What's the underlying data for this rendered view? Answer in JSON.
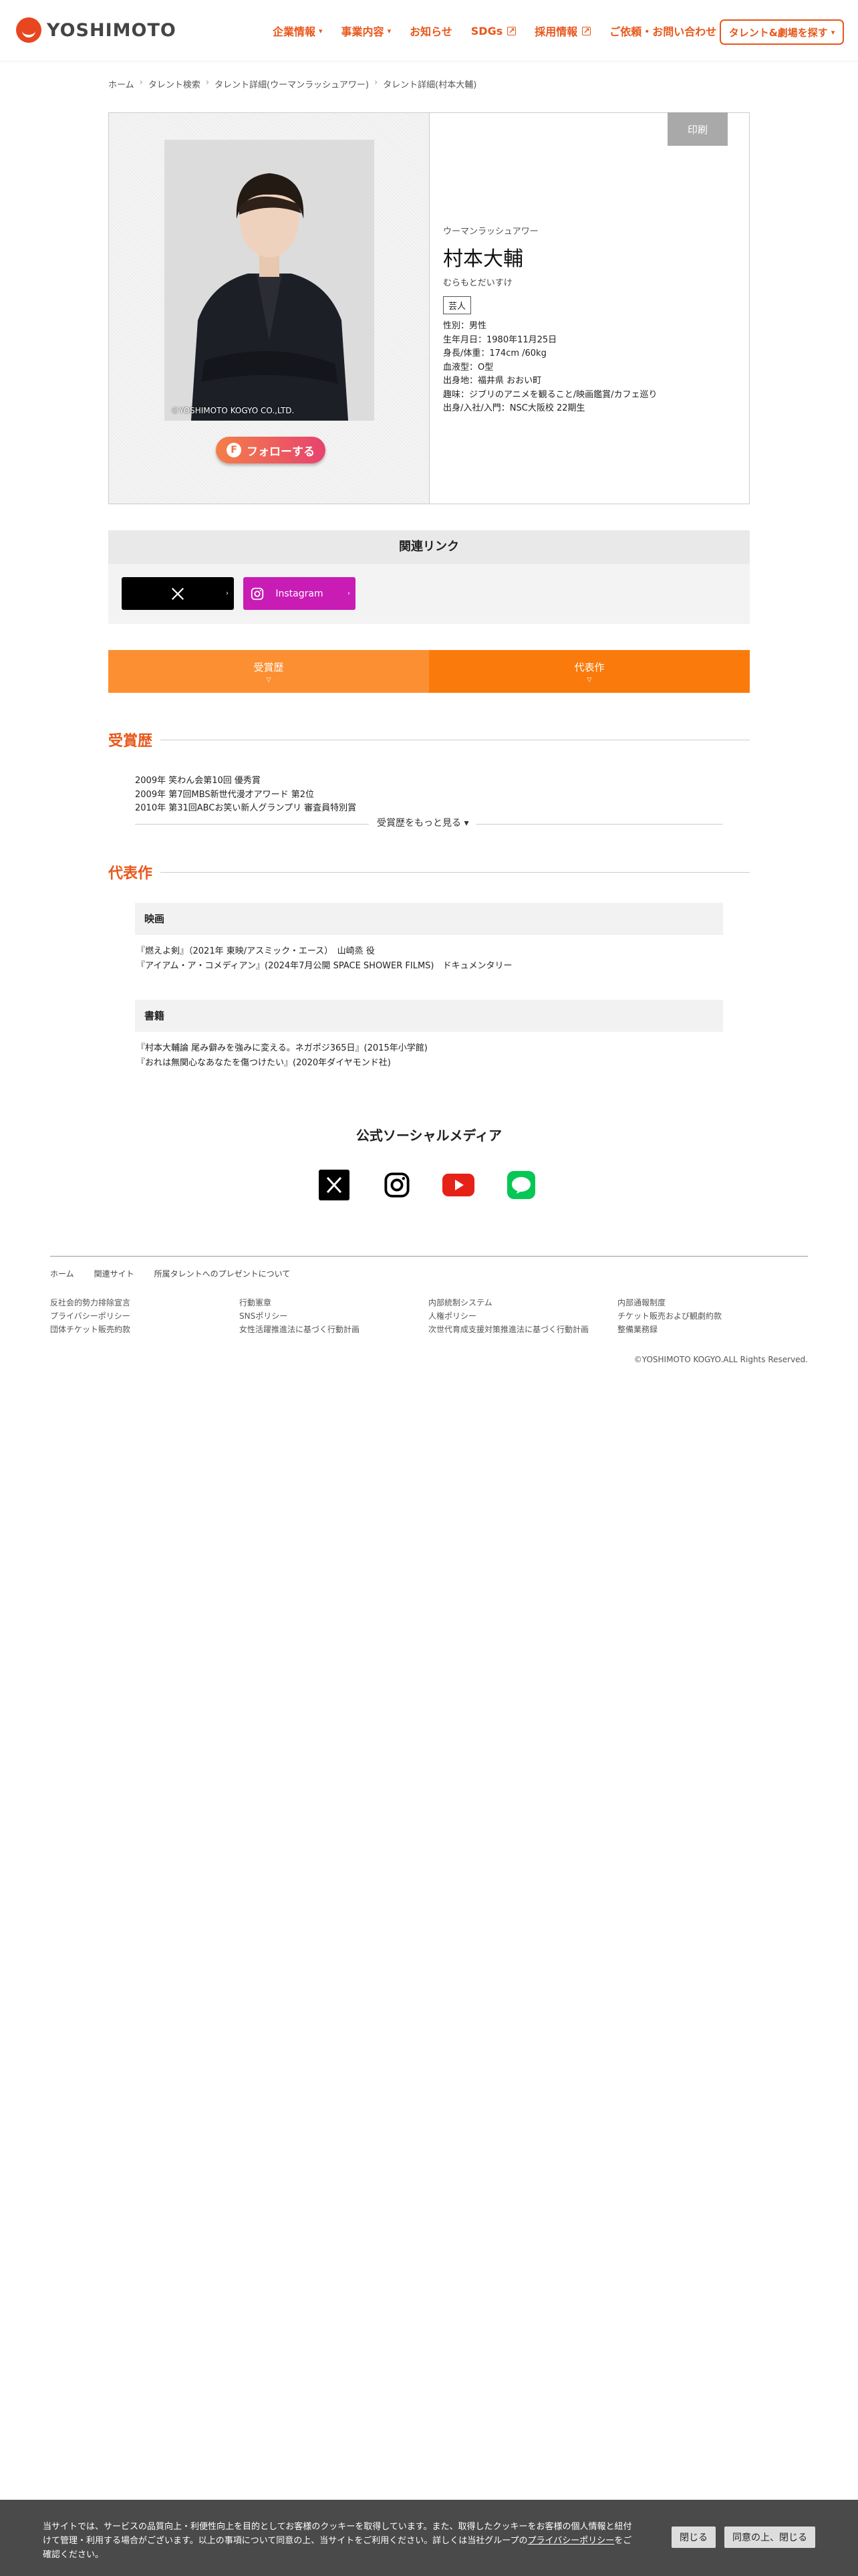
{
  "header": {
    "logo_text": "YOSHIMOTO",
    "nav": [
      {
        "label": "企業情報",
        "icon": "chevron-down-icon"
      },
      {
        "label": "事業内容",
        "icon": "chevron-down-icon"
      },
      {
        "label": "お知らせ",
        "icon": ""
      },
      {
        "label": "SDGs",
        "icon": "external-link-icon"
      },
      {
        "label": "採用情報",
        "icon": "external-link-icon"
      },
      {
        "label": "ご依頼・お問い合わせ",
        "icon": ""
      }
    ],
    "talent_button": "タレント&劇場を探す"
  },
  "breadcrumb": [
    "ホーム",
    "タレント検索",
    "タレント詳細(ウーマンラッシュアワー)",
    "タレント詳細(村本大輔)"
  ],
  "profile": {
    "print_label": "印刷",
    "copyright": "©YOSHIMOTO KOGYO CO.,LTD.",
    "follow_label": "フォローする",
    "unit": "ウーマンラッシュアワー",
    "name": "村本大輔",
    "kana": "むらもとだいすけ",
    "tag": "芸人",
    "details": [
      "性別：男性",
      "生年月日：1980年11月25日",
      "身長/体重：174cm /60kg",
      "血液型：O型",
      "出身地：福井県 おおい町",
      "趣味：ジブリのアニメを観ること/映画鑑賞/カフェ巡り",
      "出身/入社/入門：NSC大阪校 22期生"
    ]
  },
  "links": {
    "title": "関連リンク",
    "items": [
      {
        "label": "X",
        "color": "#000000"
      },
      {
        "label": "Instagram",
        "color": "#c91cb5"
      }
    ]
  },
  "tabs": [
    {
      "label": "受賞歴",
      "color": "#fc8f32"
    },
    {
      "label": "代表作",
      "color": "#fa7b0c"
    }
  ],
  "awards": {
    "title": "受賞歴",
    "items": [
      "2009年 笑わん会第10回 優秀賞",
      "2009年 第7回MBS新世代漫才アワード 第2位",
      "2010年 第31回ABCお笑い新人グランプリ 審査員特別賞"
    ],
    "more_label": "受賞歴をもっと見る"
  },
  "works": {
    "title": "代表作",
    "groups": [
      {
        "heading": "映画",
        "items": [
          "『燃えよ剣』（2021年 東映/アスミック・エース）　山崎烝 役",
          "『アイアム・ア・コメディアン』(2024年7月公開 SPACE SHOWER FILMS)　ドキュメンタリー"
        ]
      },
      {
        "heading": "書籍",
        "items": [
          "『村本大輔論 尾み僻みを強みに変える。ネガポジ365日』(2015年小学館)",
          "『おれは無関心なあなたを傷つけたい』(2020年ダイヤモンド社)"
        ]
      }
    ]
  },
  "social": {
    "title": "公式ソーシャルメディア",
    "icons": [
      "x-icon",
      "instagram-icon",
      "youtube-icon",
      "line-icon"
    ]
  },
  "footer": {
    "nav": [
      "ホーム",
      "関連サイト",
      "所属タレントへのプレゼントについて"
    ],
    "columns": [
      [
        "反社会的勢力排除宣言",
        "プライバシーポリシー",
        "団体チケット販売約款"
      ],
      [
        "行動憲章",
        "SNSポリシー",
        "女性活躍推進法に基づく行動計画"
      ],
      [
        "内部統制システム",
        "人権ポリシー",
        "次世代育成支援対策推進法に基づく行動計画"
      ],
      [
        "内部通報制度",
        "チケット販売および観劇約款",
        "整備業務録"
      ]
    ],
    "copyright": "©YOSHIMOTO KOGYO.ALL Rights Reserved."
  },
  "cookie": {
    "text_a": "当サイトでは、サービスの品質向上・利便性向上を目的としてお客様のクッキーを取得しています。また、取得したクッキーをお客様の個人情報と紐付けて管理・利用する場合がございます。以上の事項について同意の上、当サイトをご利用ください。詳しくは当社グループの",
    "link": "プライバシーポリシー",
    "text_b": "をご確認ください。",
    "close_label": "閉じる",
    "agree_label": "同意の上、閉じる"
  }
}
